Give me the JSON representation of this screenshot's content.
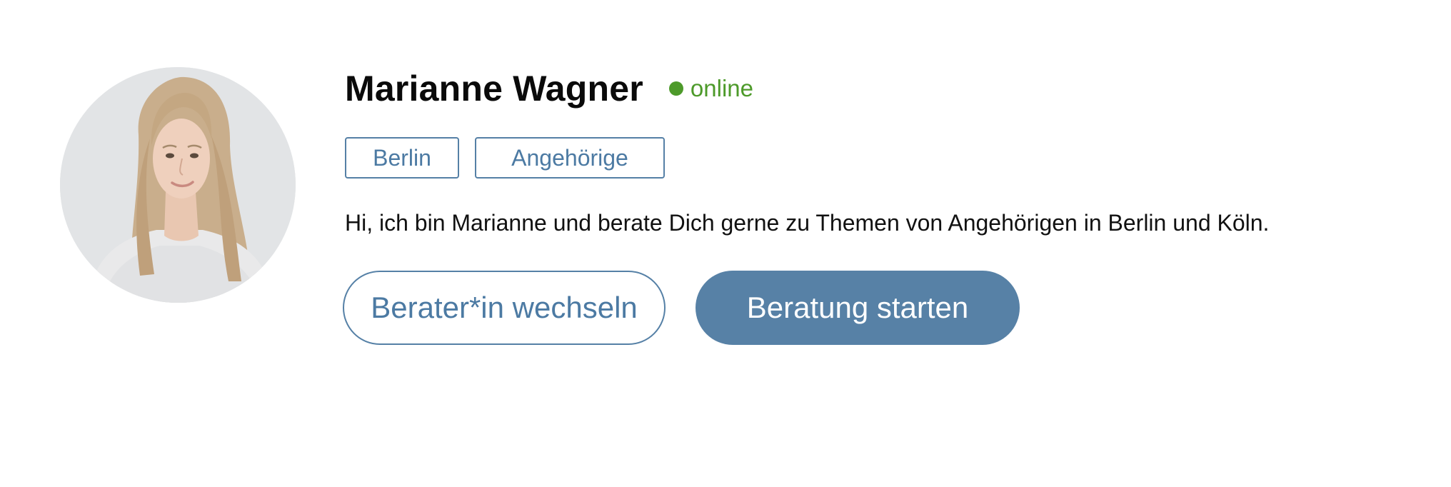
{
  "profile": {
    "name": "Marianne Wagner",
    "status_label": "online",
    "tags": [
      "Berlin",
      "Angehörige"
    ],
    "description": "Hi, ich bin Marianne und berate Dich gerne zu Themen von Angehörigen in Berlin und Köln."
  },
  "actions": {
    "switch_label": "Berater*in wechseln",
    "start_label": "Beratung starten"
  },
  "colors": {
    "status_online": "#4d9a2a",
    "accent": "#5580a6",
    "primary_button": "#5781a6"
  }
}
